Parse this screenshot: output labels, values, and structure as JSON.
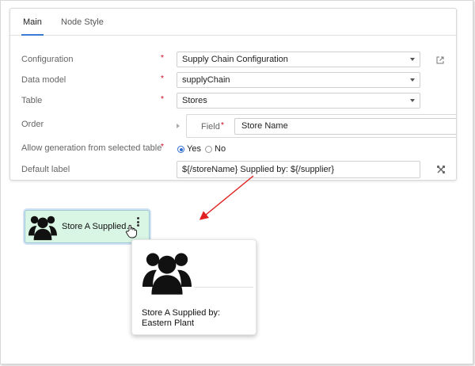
{
  "tabs": [
    {
      "label": "Main",
      "active": true
    },
    {
      "label": "Node Style",
      "active": false
    }
  ],
  "form": {
    "configuration": {
      "label": "Configuration",
      "value": "Supply Chain Configuration",
      "required": "*"
    },
    "data_model": {
      "label": "Data model",
      "value": "supplyChain",
      "required": "*"
    },
    "table": {
      "label": "Table",
      "value": "Stores",
      "required": "*"
    },
    "order": {
      "label": "Order",
      "field_label": "Field",
      "field_required": "*",
      "field_value": "Store Name"
    },
    "allow_generation": {
      "label": "Allow generation from selected table",
      "required": "*",
      "yes": "Yes",
      "no": "No",
      "selected": "Yes"
    },
    "default_label": {
      "label": "Default label",
      "value": "${/storeName} Supplied by: ${/supplier}"
    }
  },
  "node": {
    "text": "Store A Supplied by: Eastern Plant",
    "background": "#d9f5e3"
  },
  "popup": {
    "text": "Store A Supplied by: Eastern Plant"
  },
  "icons": {
    "external_link": "external-link-icon",
    "tools": "tools-icon",
    "group": "user-group-icon",
    "cursor": "hand-pointer-icon"
  },
  "colors": {
    "accent": "#3a7bd5",
    "required": "#d0021b",
    "arrow": "#e02020"
  }
}
